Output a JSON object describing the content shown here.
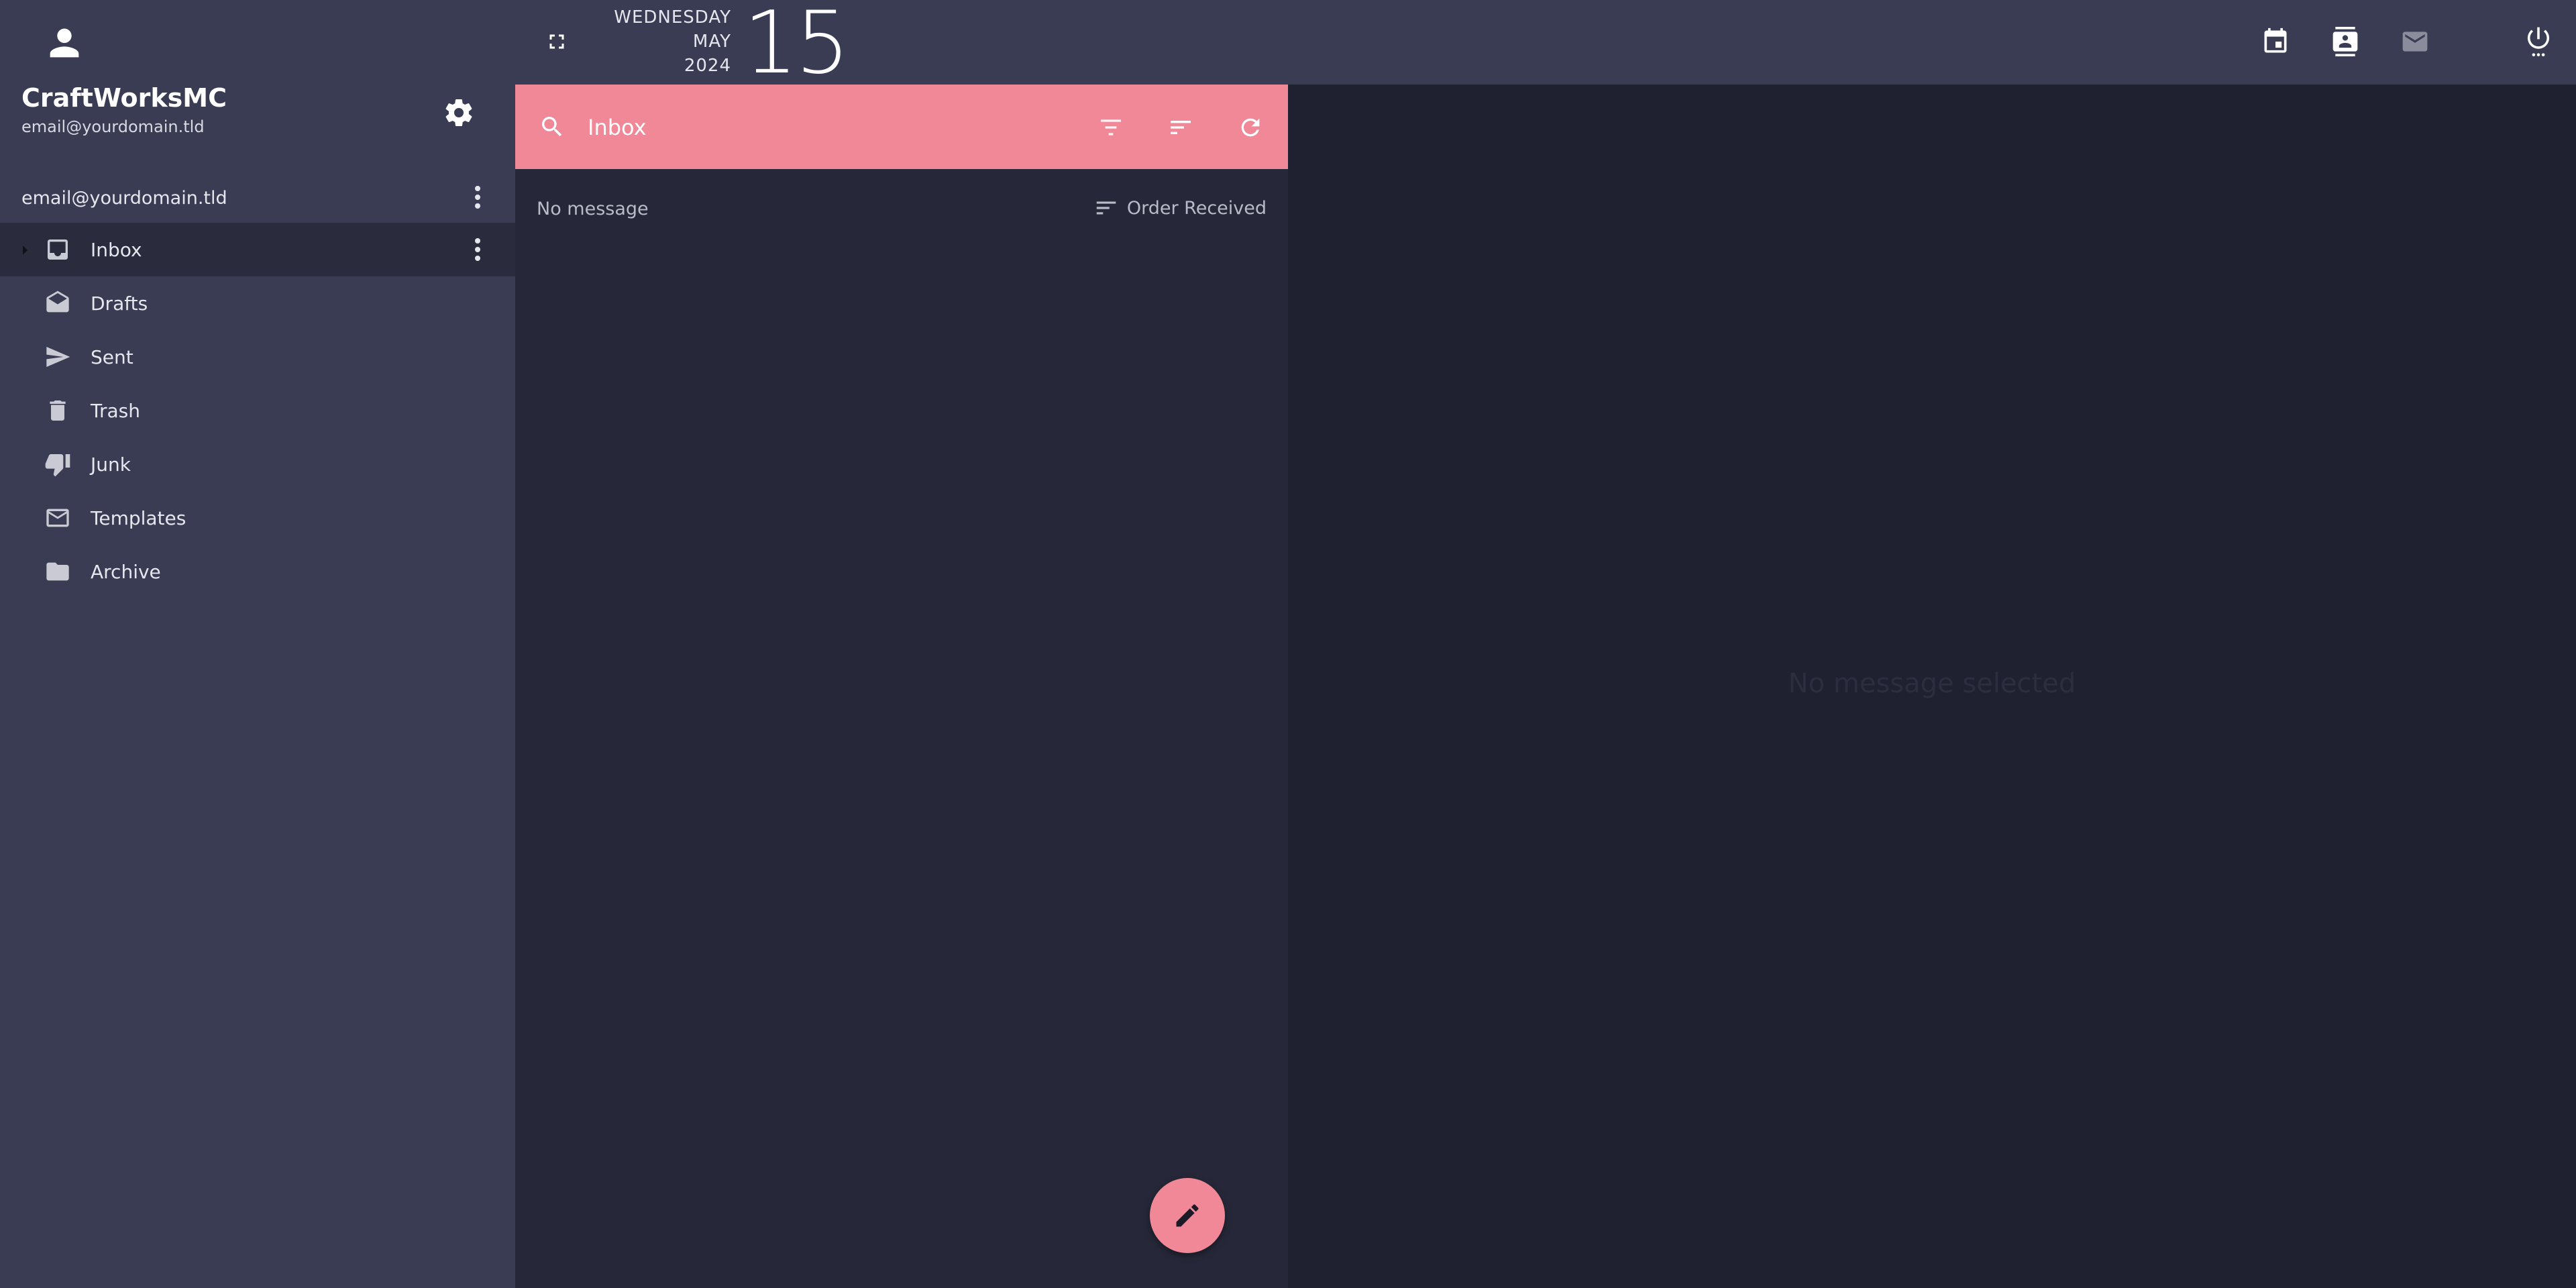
{
  "user": {
    "name": "CraftWorksMC",
    "email": "email@yourdomain.tld"
  },
  "account": {
    "label": "email@yourdomain.tld"
  },
  "folders": [
    {
      "label": "Inbox",
      "icon": "inbox-icon",
      "active": true
    },
    {
      "label": "Drafts",
      "icon": "drafts-icon"
    },
    {
      "label": "Sent",
      "icon": "send-icon"
    },
    {
      "label": "Trash",
      "icon": "trash-icon"
    },
    {
      "label": "Junk",
      "icon": "thumb-down-icon"
    },
    {
      "label": "Templates",
      "icon": "mail-outline-icon"
    },
    {
      "label": "Archive",
      "icon": "folder-icon"
    }
  ],
  "date": {
    "weekday": "WEDNESDAY",
    "month": "MAY",
    "year": "2024",
    "day": "15"
  },
  "search": {
    "placeholder": "Inbox"
  },
  "message_list": {
    "status": "No message",
    "sort_label": "Order Received"
  },
  "reading_pane": {
    "empty": "No message selected"
  },
  "colors": {
    "accent": "#f08897",
    "sidebar": "#393c52",
    "list_bg": "#262839",
    "pane_bg": "#1f2030"
  }
}
